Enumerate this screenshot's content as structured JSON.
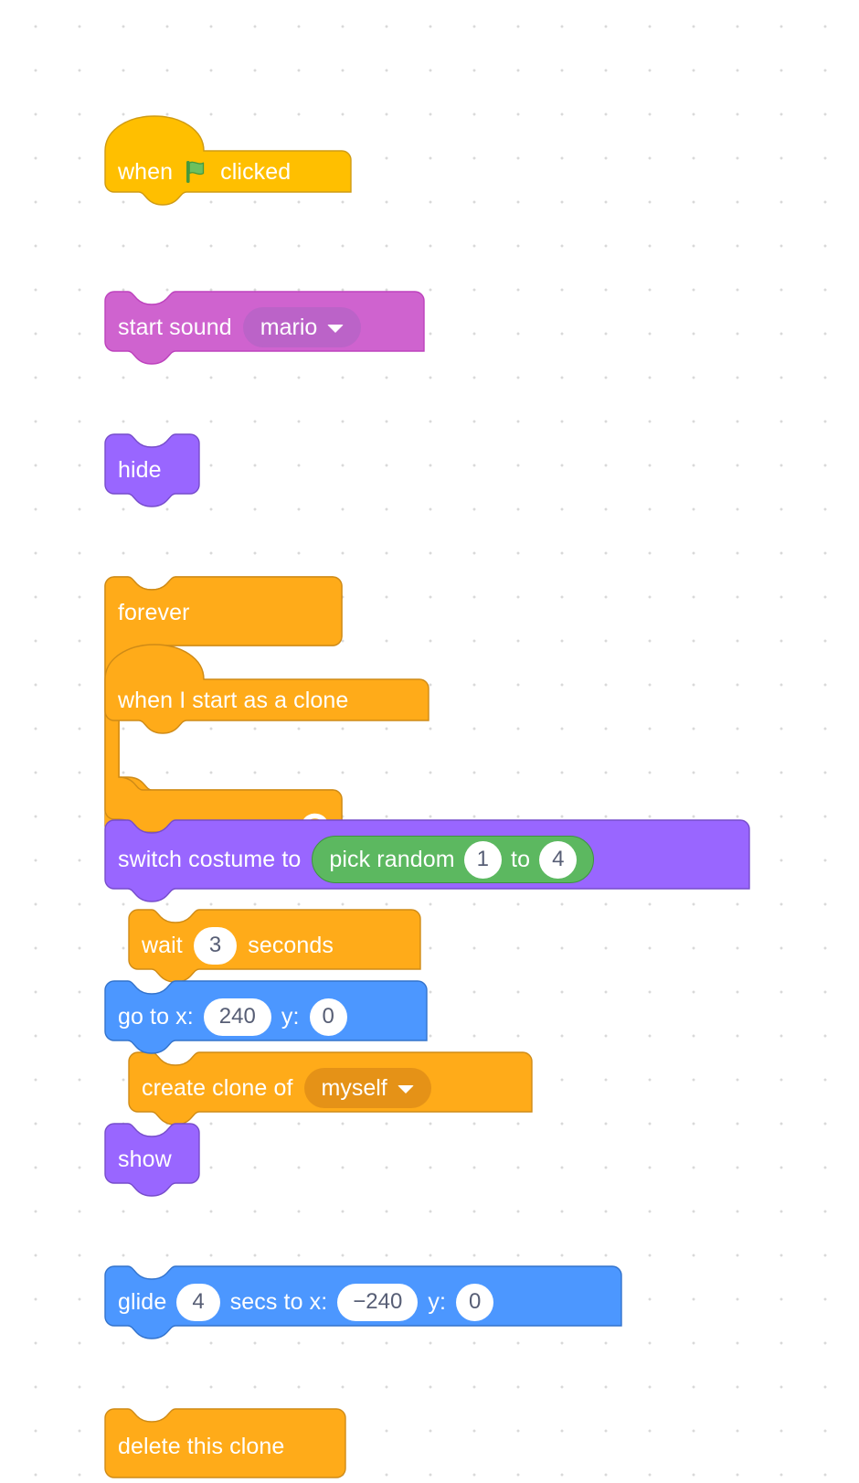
{
  "app": {
    "name": "Scratch Block Editor Canvas",
    "background": "#ffffff",
    "grid_dot_color": "#d9d9d9"
  },
  "palette": {
    "events_yellow": "#ffbf00",
    "events_yellow_stroke": "#cf9b14",
    "sound_magenta": "#cf63cf",
    "sound_magenta_stroke": "#bd42bd",
    "looks_purple": "#9966ff",
    "looks_purple_stroke": "#774dcb",
    "control_orange": "#ffab19",
    "control_orange_stroke": "#cf8b17",
    "motion_blue": "#4c97ff",
    "motion_blue_stroke": "#3373cc",
    "operators_green": "#59c059",
    "operators_green_stroke": "#389438",
    "input_white": "#ffffff",
    "input_text": "#575e75"
  },
  "scripts": [
    {
      "id": "script-green-flag",
      "blocks": [
        {
          "name": "when-flag-clicked-block",
          "category": "events",
          "shape": "hat",
          "text_before": "when",
          "icon": "green-flag-icon",
          "text_after": "clicked"
        },
        {
          "name": "start-sound-block",
          "category": "sound",
          "shape": "stack",
          "label": "start sound",
          "field": {
            "name": "sound-dropdown",
            "type": "dropdown",
            "value": "mario"
          }
        },
        {
          "name": "hide-block",
          "category": "looks",
          "shape": "stack",
          "label": "hide"
        },
        {
          "name": "forever-block",
          "category": "control",
          "shape": "c-block",
          "label": "forever",
          "icon": "loop-arrow-icon",
          "children": [
            {
              "name": "wait-seconds-block",
              "category": "control",
              "shape": "stack",
              "label_before": "wait",
              "input": {
                "name": "wait-duration-input",
                "type": "number",
                "value": "3"
              },
              "label_after": "seconds"
            },
            {
              "name": "create-clone-block",
              "category": "control",
              "shape": "stack",
              "label": "create clone of",
              "field": {
                "name": "clone-target-dropdown",
                "type": "dropdown",
                "value": "myself"
              }
            }
          ]
        }
      ]
    },
    {
      "id": "script-clone-start",
      "blocks": [
        {
          "name": "when-i-start-as-clone-block",
          "category": "control",
          "shape": "hat",
          "label": "when I start as a clone"
        },
        {
          "name": "switch-costume-block",
          "category": "looks",
          "shape": "stack",
          "label": "switch costume to",
          "reporter": {
            "name": "pick-random-block",
            "category": "operators",
            "label_before": "pick random",
            "from": "1",
            "label_middle": "to",
            "to": "4"
          }
        },
        {
          "name": "go-to-xy-block",
          "category": "motion",
          "shape": "stack",
          "label_x": "go to x:",
          "x_value": "240",
          "label_y": "y:",
          "y_value": "0"
        },
        {
          "name": "show-block",
          "category": "looks",
          "shape": "stack",
          "label": "show"
        },
        {
          "name": "glide-to-xy-block",
          "category": "motion",
          "shape": "stack",
          "label_glide": "glide",
          "secs_value": "4",
          "label_secs": "secs to x:",
          "x_value": "−240",
          "label_y": "y:",
          "y_value": "0"
        },
        {
          "name": "delete-this-clone-block",
          "category": "control",
          "shape": "cap",
          "label": "delete this clone"
        }
      ]
    }
  ]
}
